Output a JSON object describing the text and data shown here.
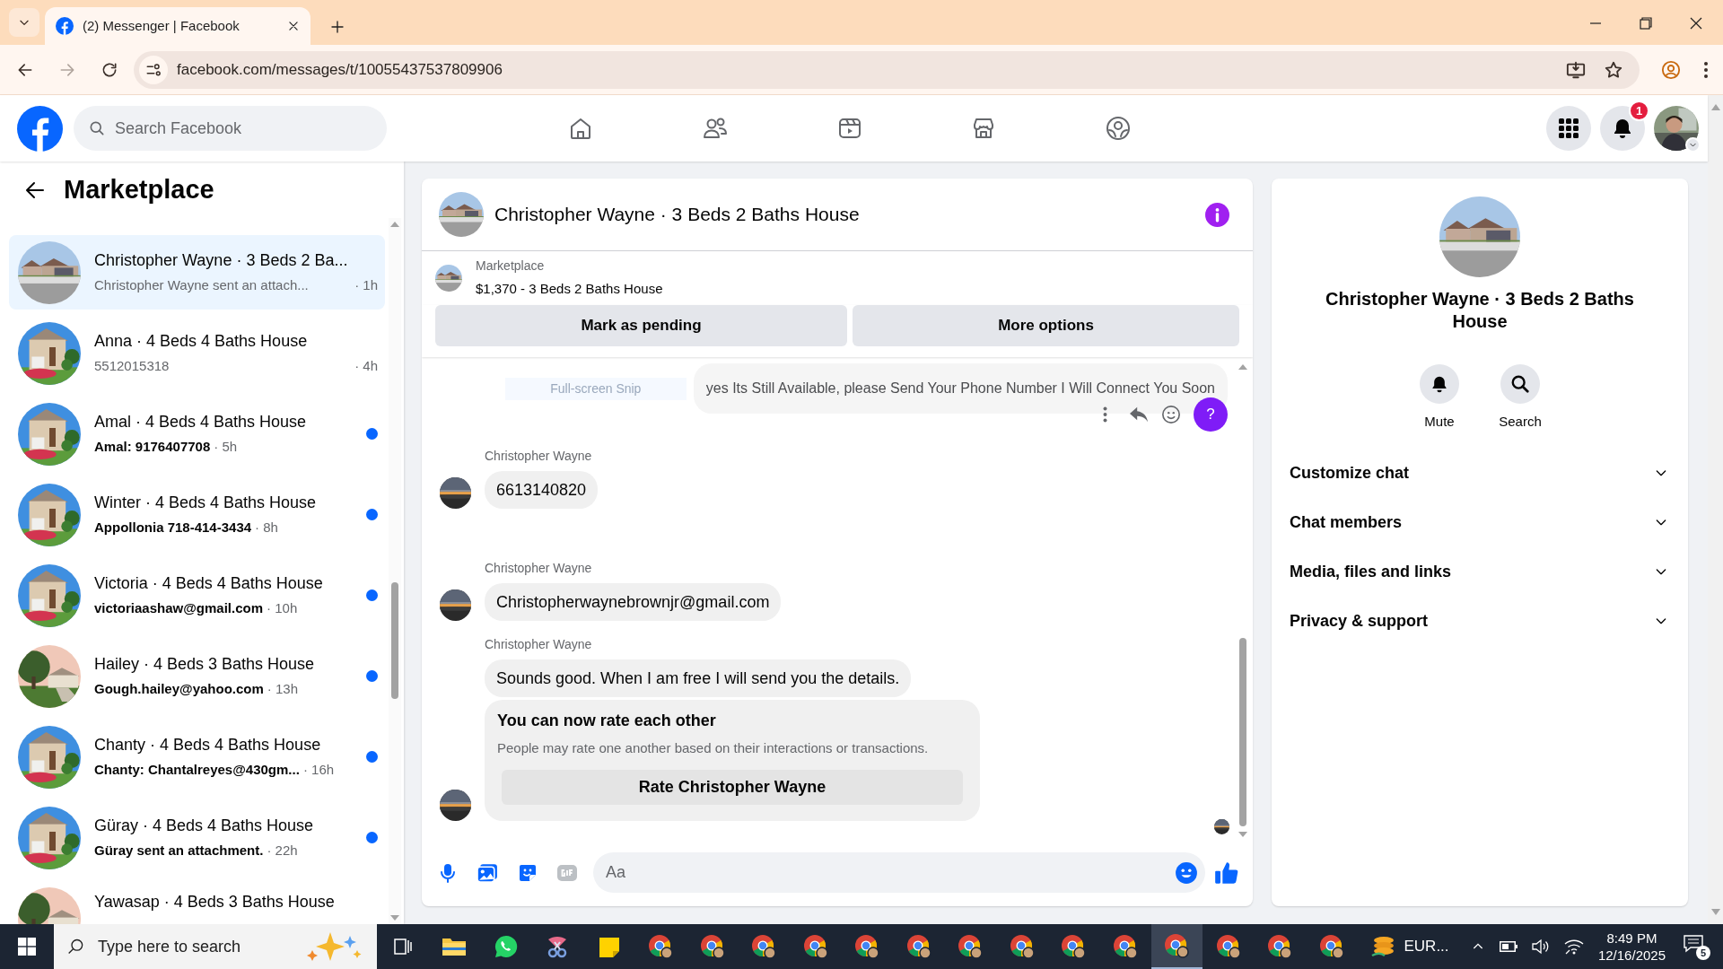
{
  "browser": {
    "tab_title": "(2) Messenger | Facebook",
    "url": "facebook.com/messages/t/10055437537809906"
  },
  "header": {
    "search_placeholder": "Search Facebook",
    "notification_count": "1"
  },
  "sidebar": {
    "title": "Marketplace",
    "conversations": [
      {
        "title": "Christopher Wayne · 3 Beds 2 Ba...",
        "preview": "Christopher Wayne sent an attach...",
        "time": "· 1h",
        "unread": false,
        "selected": true
      },
      {
        "title": "Anna · 4 Beds 4 Baths House",
        "preview": "5512015318",
        "time": "· 4h",
        "unread": false,
        "selected": false
      },
      {
        "title": "Amal · 4 Beds 4 Baths House",
        "preview": "Amal: 9176407708",
        "time": "· 5h",
        "unread": true,
        "selected": false
      },
      {
        "title": "Winter · 4 Beds 4 Baths House",
        "preview": "Appollonia 718-414-3434",
        "time": "· 8h",
        "unread": true,
        "selected": false
      },
      {
        "title": "Victoria · 4 Beds 4 Baths House",
        "preview": "victoriaashaw@gmail.com",
        "time": "· 10h",
        "unread": true,
        "selected": false
      },
      {
        "title": "Hailey · 4 Beds 3 Baths House",
        "preview": "Gough.hailey@yahoo.com",
        "time": "· 13h",
        "unread": true,
        "selected": false
      },
      {
        "title": "Chanty · 4 Beds 4 Baths House",
        "preview": "Chanty: Chantalreyes@430gm...",
        "time": "· 16h",
        "unread": true,
        "selected": false
      },
      {
        "title": "Güray · 4 Beds 4 Baths House",
        "preview": "Güray sent an attachment.",
        "time": "· 22h",
        "unread": true,
        "selected": false
      },
      {
        "title": "Yawasap · 4 Beds 3 Baths House",
        "unread": false,
        "selected": false
      }
    ]
  },
  "chat": {
    "title": "Christopher Wayne · 3 Beds 2 Baths House",
    "listing_label": "Marketplace",
    "listing_title": "$1,370 - 3 Beds 2 Baths House",
    "actions": [
      "Mark as pending",
      "More options"
    ],
    "snip_hint": "Full-screen Snip",
    "messages": [
      {
        "kind": "outgoing",
        "text": "yes Its Still Available, please Send Your Phone Number I Will Connect You Soon",
        "help": "?"
      },
      {
        "kind": "incoming",
        "sender": "Christopher Wayne",
        "text": "6613140820",
        "avatar": true
      },
      {
        "kind": "incoming",
        "sender": "Christopher Wayne",
        "text": "Christopherwaynebrownjr@gmail.com",
        "avatar": true
      },
      {
        "kind": "incoming",
        "sender": "Christopher Wayne",
        "text": "Sounds good. When I am free I will send you the details.",
        "avatar": false
      },
      {
        "kind": "rating",
        "title": "You can now rate each other",
        "text": "People may rate one another based on their interactions or transactions.",
        "button": "Rate Christopher Wayne",
        "avatar": true
      }
    ],
    "composer_placeholder": "Aa"
  },
  "info": {
    "title": "Christopher Wayne · 3 Beds 2 Baths House",
    "actions": [
      {
        "kind": "mute",
        "label": "Mute"
      },
      {
        "kind": "search",
        "label": "Search"
      }
    ],
    "sections": [
      "Customize chat",
      "Chat members",
      "Media, files and links",
      "Privacy & support"
    ]
  },
  "taskbar": {
    "search_placeholder": "Type here to search",
    "apps": [
      {
        "kind": "taskview",
        "active": false
      },
      {
        "kind": "explorer",
        "active": false
      },
      {
        "kind": "whatsapp",
        "active": false
      },
      {
        "kind": "snip",
        "active": false
      },
      {
        "kind": "sticky",
        "active": false
      },
      {
        "kind": "chrome",
        "active": false
      },
      {
        "kind": "chrome",
        "active": false
      },
      {
        "kind": "chrome",
        "active": false
      },
      {
        "kind": "chrome",
        "active": false
      },
      {
        "kind": "chrome",
        "active": false
      },
      {
        "kind": "chrome",
        "active": false
      },
      {
        "kind": "chrome",
        "active": false
      },
      {
        "kind": "chrome",
        "active": false
      },
      {
        "kind": "chrome",
        "active": false
      },
      {
        "kind": "chrome",
        "active": false
      },
      {
        "kind": "chrome",
        "active": true
      },
      {
        "kind": "chrome",
        "active": false
      },
      {
        "kind": "chrome",
        "active": false
      },
      {
        "kind": "chrome",
        "active": false
      }
    ],
    "weather": "EUR...",
    "time": "8:49 PM",
    "date": "12/16/2025",
    "notifications": "5"
  }
}
